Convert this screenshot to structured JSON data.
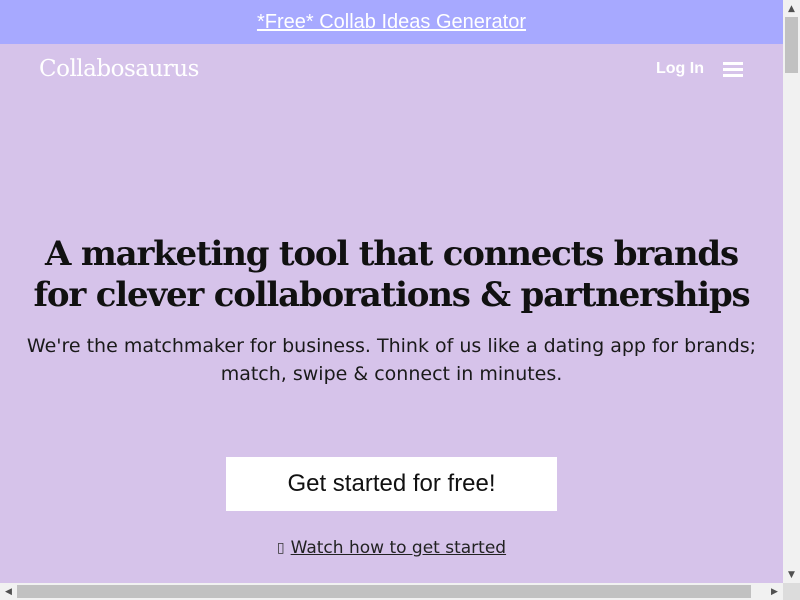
{
  "promo": {
    "link_text": "*Free* Collab Ideas Generator"
  },
  "header": {
    "logo_text": "Collabosaurus",
    "login_label": "Log In",
    "menu_icon": "hamburger-menu-icon"
  },
  "hero": {
    "title": "A marketing tool that connects brands for clever collaborations & partnerships",
    "subtitle": "We're the matchmaker for business. Think of us like a dating app for brands; match, swipe & connect in minutes."
  },
  "cta": {
    "label": "Get started for free!"
  },
  "watch": {
    "icon": "play-icon",
    "label": "Watch how to get started"
  },
  "scrollbars": {
    "vertical_arrow_up": "▲",
    "vertical_arrow_down": "▼",
    "horizontal_arrow_left": "◀",
    "horizontal_arrow_right": "▶"
  },
  "colors": {
    "page_background": "#d6c3ea",
    "promo_background": "#a7a9ff",
    "cta_background": "#ffffff"
  }
}
